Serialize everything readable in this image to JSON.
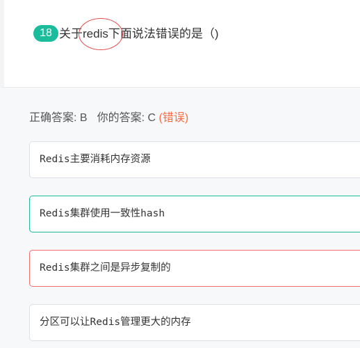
{
  "question": {
    "number": "18",
    "text_before": "关于",
    "text_highlight": "redis",
    "text_after": "下面说法错误的是（)"
  },
  "answer": {
    "correct_label": "正确答案:",
    "correct_value": "B",
    "yours_label": "你的答案:",
    "yours_value": "C",
    "result": "(错误)"
  },
  "options": [
    {
      "text": "Redis主要消耗内存资源"
    },
    {
      "text": "Redis集群使用一致性hash"
    },
    {
      "text": "Redis集群之间是异步复制的"
    },
    {
      "text": "分区可以让Redis管理更大的内存"
    }
  ],
  "colors": {
    "badge": "#1abc9c",
    "correct_border": "#1abc9c",
    "wrong_border": "#f56c6c",
    "wrong_text": "#ff6a3d",
    "circle": "#e04b4b"
  }
}
